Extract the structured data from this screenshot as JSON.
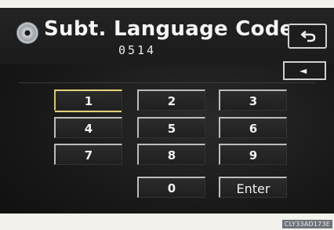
{
  "header": {
    "title": "Subt. Language Code",
    "code_value": "0514"
  },
  "icons": {
    "disc": "disc-icon",
    "return": "return-arrow-icon",
    "back": "triangle-left-icon"
  },
  "back_label": "◄",
  "keypad": {
    "keys": [
      {
        "label": "1",
        "selected": true
      },
      {
        "label": "2"
      },
      {
        "label": "3"
      },
      {
        "label": "4"
      },
      {
        "label": "5"
      },
      {
        "label": "6"
      },
      {
        "label": "7"
      },
      {
        "label": "8"
      },
      {
        "label": "9"
      },
      {
        "label": "0"
      },
      {
        "label": "Enter"
      }
    ]
  },
  "footer": {
    "figure_code": "CLY33AD173E"
  },
  "colors": {
    "background": "#181918",
    "text": "#f0f0f0",
    "highlight": "#e2cf75"
  }
}
